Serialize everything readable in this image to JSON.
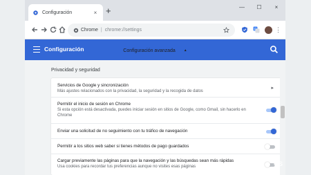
{
  "tab": {
    "title": "Configuración",
    "close": "×",
    "new_tab": "+"
  },
  "window_controls": {
    "minimize": "—",
    "maximize": "☐",
    "close": "×"
  },
  "omnibox": {
    "site_label": "Chrome",
    "separator": "|",
    "url": "chrome://settings"
  },
  "appbar": {
    "title": "Configuración"
  },
  "advanced": {
    "label": "Configuración avanzada",
    "chevron": "▲"
  },
  "section": {
    "title": "Privacidad y seguridad"
  },
  "rows": [
    {
      "title": "Servicios de Google y sincronización",
      "subtitle": "Más ajustes relacionados con la privacidad, la seguridad y la recogida de datos",
      "control": "arrow",
      "arrow": "▸"
    },
    {
      "title": "Permitir el inicio de sesión en Chrome",
      "subtitle": "Si esta opción está desactivada, puedes iniciar sesión en sitios de Google, como Gmail, sin hacerlo en Chrome",
      "control": "toggle",
      "on": true
    },
    {
      "title": "Enviar una solicitud de no seguimiento con tu tráfico de navegación",
      "subtitle": "",
      "control": "toggle",
      "on": true
    },
    {
      "title": "Permitir a los sitios web saber si tienes métodos de pago guardados",
      "subtitle": "",
      "control": "toggle",
      "on": false
    },
    {
      "title": "Cargar previamente las páginas para que la navegación y las búsquedas sean más rápidas",
      "subtitle": "Usa cookies para recordar tus preferencias aunque no visites esas páginas",
      "control": "toggle",
      "on": false
    }
  ],
  "watermark": "CS",
  "colors": {
    "accent": "#3367d6",
    "toggle_on_track": "#a8c7fa",
    "toggle_off_track": "#bdc1c6"
  },
  "icons": [
    "gear-icon",
    "close-icon",
    "plus-icon",
    "back-arrow-icon",
    "forward-arrow-icon",
    "reload-icon",
    "home-icon",
    "secure-icon",
    "star-icon",
    "shield-icon",
    "translate-icon",
    "avatar",
    "kebab-menu-icon",
    "hamburger-icon",
    "search-icon",
    "chevron-up-icon",
    "chevron-right-icon"
  ]
}
